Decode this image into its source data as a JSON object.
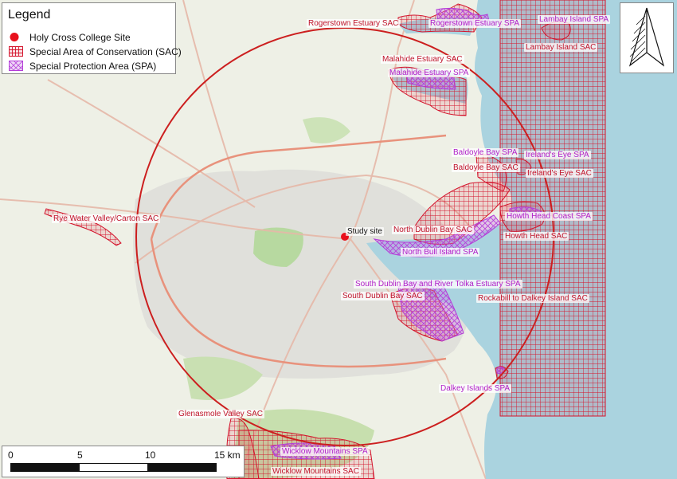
{
  "legend": {
    "title": "Legend",
    "items": [
      {
        "label": "Holy Cross College Site",
        "symbol": "red-dot"
      },
      {
        "label": "Special Area of Conservation (SAC)",
        "symbol": "red-grid-hatch"
      },
      {
        "label": "Special Protection Area (SPA)",
        "symbol": "purple-crosshatch"
      }
    ]
  },
  "study_site": {
    "label": "Study site",
    "color": "#e8101c"
  },
  "buffer_circle": {
    "radius_km": 15,
    "color": "#cc1f1f"
  },
  "scale_bar": {
    "ticks": [
      "0",
      "5",
      "10",
      "15 km"
    ]
  },
  "north_arrow": {
    "icon": "north-arrow-icon"
  },
  "colors": {
    "sac": "#d4142c",
    "spa": "#b43cd8",
    "sea": "#aad3df",
    "land": "#eef0e6",
    "urban": "#dcdcd8"
  },
  "sac_labels": {
    "rogerstown": "Rogerstown Estuary SAC",
    "lambay": "Lambay Island SAC",
    "malahide": "Malahide Estuary SAC",
    "baldoyle": "Baldoyle Bay SAC",
    "irelands_eye": "Ireland's Eye SAC",
    "rye_water": "Rye Water Valley/Carton SAC",
    "north_dublin_bay": "North Dublin Bay SAC",
    "howth_head": "Howth Head SAC",
    "south_dublin_bay": "South Dublin Bay SAC",
    "rockabill": "Rockabill to Dalkey Island SAC",
    "glenasmole": "Glenasmole Valley SAC",
    "wicklow_mountains": "Wicklow Mountains SAC"
  },
  "spa_labels": {
    "rogerstown": "Rogerstown Estuary SPA",
    "lambay": "Lambay Island SPA",
    "malahide": "Malahide Estuary SPA",
    "baldoyle": "Baldoyle Bay SPA",
    "irelands_eye": "Ireland's Eye SPA",
    "howth_head_coast": "Howth Head Coast SPA",
    "north_bull_island": "North Bull Island SPA",
    "south_dublin_bay_tolka": "South Dublin Bay and River Tolka Estuary SPA",
    "dalkey_islands": "Dalkey Islands SPA",
    "wicklow_mountains": "Wicklow Mountains SPA"
  }
}
